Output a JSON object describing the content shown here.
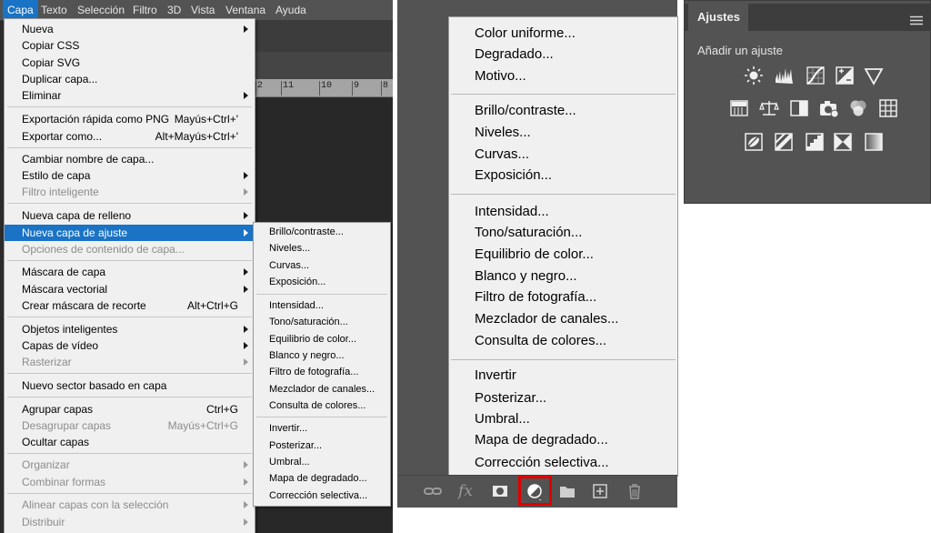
{
  "menubar": {
    "items": [
      "Capa",
      "Texto",
      "Selección",
      "Filtro",
      "3D",
      "Vista",
      "Ventana",
      "Ayuda"
    ],
    "active": "Capa"
  },
  "ruler": {
    "ticks": [
      "2",
      "11",
      "10",
      "9",
      "8"
    ]
  },
  "capa_menu": {
    "items": [
      {
        "label": "Nueva",
        "submenu": true
      },
      {
        "label": "Copiar CSS"
      },
      {
        "label": "Copiar SVG"
      },
      {
        "label": "Duplicar capa..."
      },
      {
        "label": "Eliminar",
        "submenu": true
      },
      {
        "label": "Exportación rápida como PNG",
        "shortcut": "Mayús+Ctrl+'"
      },
      {
        "label": "Exportar como...",
        "shortcut": "Alt+Mayús+Ctrl+'"
      },
      {
        "label": "Cambiar nombre de capa..."
      },
      {
        "label": "Estilo de capa",
        "submenu": true
      },
      {
        "label": "Filtro inteligente",
        "submenu": true,
        "disabled": true
      },
      {
        "label": "Nueva capa de relleno",
        "submenu": true
      },
      {
        "label": "Nueva capa de ajuste",
        "submenu": true,
        "highlighted": true
      },
      {
        "label": "Opciones de contenido de capa...",
        "disabled": true
      },
      {
        "label": "Máscara de capa",
        "submenu": true
      },
      {
        "label": "Máscara vectorial",
        "submenu": true
      },
      {
        "label": "Crear máscara de recorte",
        "shortcut": "Alt+Ctrl+G"
      },
      {
        "label": "Objetos inteligentes",
        "submenu": true
      },
      {
        "label": "Capas de vídeo",
        "submenu": true
      },
      {
        "label": "Rasterizar",
        "submenu": true,
        "disabled": true
      },
      {
        "label": "Nuevo sector basado en capa"
      },
      {
        "label": "Agrupar capas",
        "shortcut": "Ctrl+G"
      },
      {
        "label": "Desagrupar capas",
        "shortcut": "Mayús+Ctrl+G",
        "disabled": true
      },
      {
        "label": "Ocultar capas"
      },
      {
        "label": "Organizar",
        "submenu": true,
        "disabled": true
      },
      {
        "label": "Combinar formas",
        "submenu": true,
        "disabled": true
      },
      {
        "label": "Alinear capas con la selección",
        "submenu": true,
        "disabled": true
      },
      {
        "label": "Distribuir",
        "submenu": true,
        "disabled": true
      }
    ]
  },
  "submenu": {
    "items": [
      "Brillo/contraste...",
      "Niveles...",
      "Curvas...",
      "Exposición...",
      "Intensidad...",
      "Tono/saturación...",
      "Equilibrio de color...",
      "Blanco y negro...",
      "Filtro de fotografía...",
      "Mezclador de canales...",
      "Consulta de colores...",
      "Invertir...",
      "Posterizar...",
      "Umbral...",
      "Mapa de degradado...",
      "Corrección selectiva..."
    ]
  },
  "adjust_popup": {
    "items": [
      "Color uniforme...",
      "Degradado...",
      "Motivo...",
      "Brillo/contraste...",
      "Niveles...",
      "Curvas...",
      "Exposición...",
      "Intensidad...",
      "Tono/saturación...",
      "Equilibrio de color...",
      "Blanco y negro...",
      "Filtro de fotografía...",
      "Mezclador de canales...",
      "Consulta de colores...",
      "Invertir",
      "Posterizar...",
      "Umbral...",
      "Mapa de degradado...",
      "Corrección selectiva..."
    ]
  },
  "layers_bar": {
    "icons": [
      "link-icon",
      "fx-icon",
      "mask-icon",
      "adjustment-layer-icon",
      "folder-icon",
      "new-layer-icon",
      "trash-icon"
    ],
    "fx_label": "fx",
    "highlight_color": "#e00000"
  },
  "ajustes_panel": {
    "title": "Ajustes",
    "subtitle": "Añadir un ajuste",
    "icons": [
      "brightness-contrast-icon",
      "levels-icon",
      "curves-icon",
      "exposure-icon",
      "vibrance-icon",
      "hue-saturation-icon",
      "color-balance-icon",
      "black-white-icon",
      "photo-filter-icon",
      "channel-mixer-icon",
      "color-lookup-icon",
      "invert-icon",
      "posterize-icon",
      "threshold-icon",
      "selective-color-icon",
      "gradient-map-icon"
    ]
  },
  "colors": {
    "highlight": "#1a73c4",
    "panel": "#535353",
    "menu_bg": "#f0f0f0"
  }
}
